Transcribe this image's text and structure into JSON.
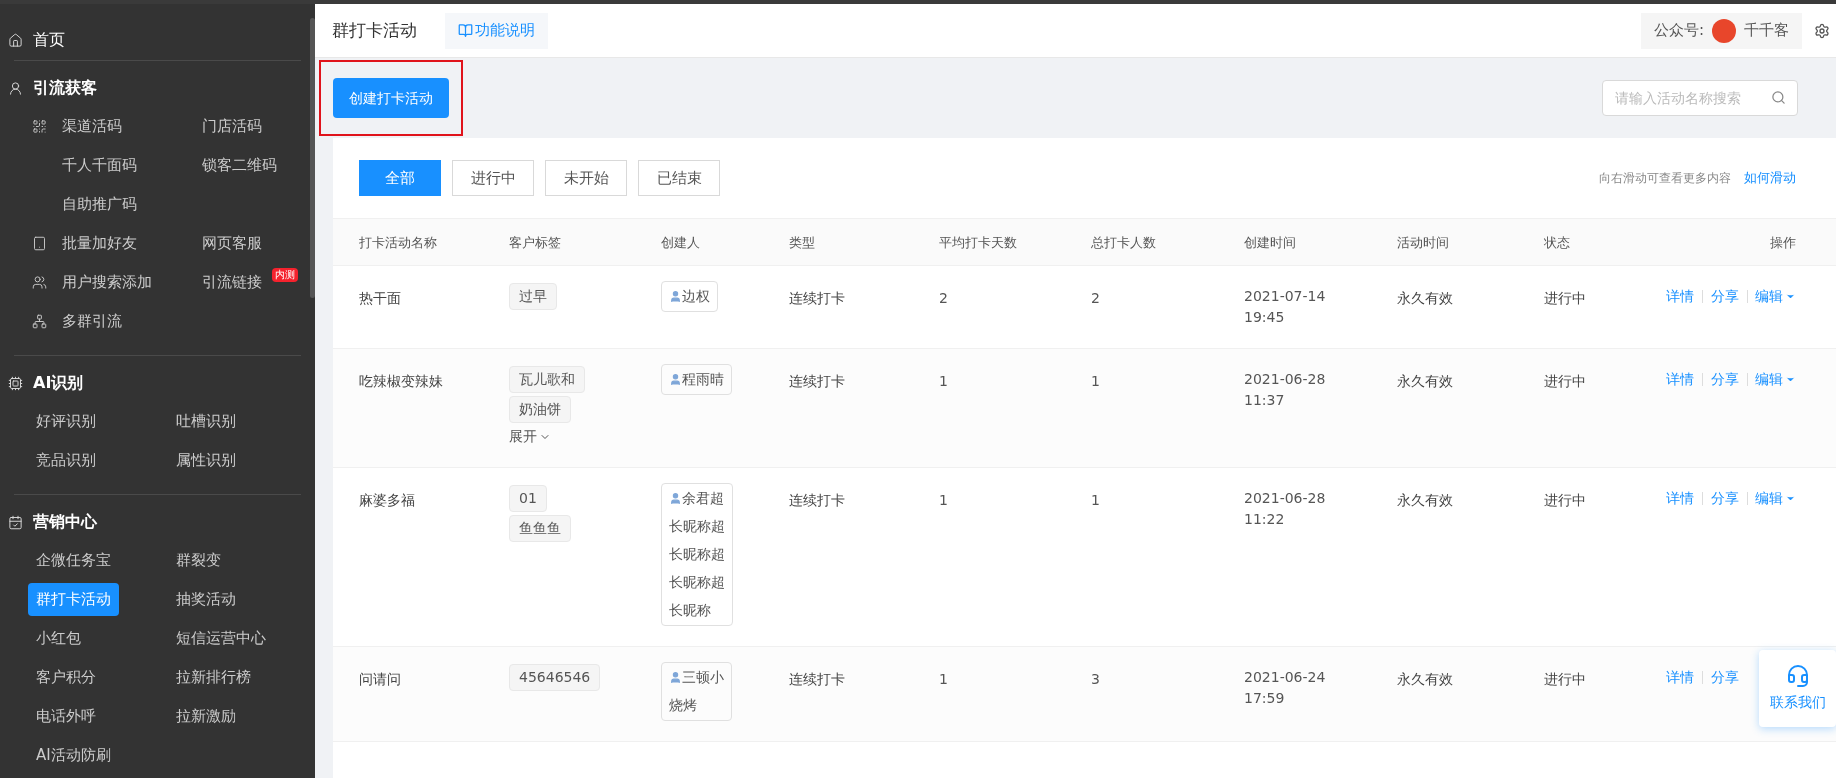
{
  "sidebar": {
    "home": {
      "label": "首页"
    },
    "sections": [
      {
        "title": "引流获客",
        "items": [
          {
            "label": "渠道活码",
            "selected": false
          },
          {
            "label": "门店活码",
            "selected": false
          },
          {
            "label": "千人千面码",
            "selected": false
          },
          {
            "label": "锁客二维码",
            "selected": false
          },
          {
            "label": "自助推广码",
            "selected": false,
            "kind": "wide"
          },
          {
            "label": "批量加好友",
            "selected": false
          },
          {
            "label": "网页客服",
            "selected": false
          },
          {
            "label": "用户搜索添加",
            "selected": false
          },
          {
            "label": "引流链接",
            "selected": false,
            "badge": "内测"
          },
          {
            "label": "多群引流",
            "selected": false
          }
        ]
      },
      {
        "title": "AI识别",
        "items": [
          {
            "label": "好评识别",
            "selected": false
          },
          {
            "label": "吐槽识别",
            "selected": false
          },
          {
            "label": "竞品识别",
            "selected": false
          },
          {
            "label": "属性识别",
            "selected": false
          }
        ]
      },
      {
        "title": "营销中心",
        "items": [
          {
            "label": "企微任务宝",
            "selected": false
          },
          {
            "label": "群裂变",
            "selected": false
          },
          {
            "label": "群打卡活动",
            "selected": true
          },
          {
            "label": "抽奖活动",
            "selected": false
          },
          {
            "label": "小红包",
            "selected": false
          },
          {
            "label": "短信运营中心",
            "selected": false
          },
          {
            "label": "客户积分",
            "selected": false
          },
          {
            "label": "拉新排行榜",
            "selected": false
          },
          {
            "label": "电话外呼",
            "selected": false
          },
          {
            "label": "拉新激励",
            "selected": false
          },
          {
            "label": "AI活动防刷",
            "selected": false
          }
        ]
      }
    ]
  },
  "header": {
    "title": "群打卡活动",
    "help": "功能说明",
    "account_label": "公众号:",
    "account_name": "千千客"
  },
  "toolbar": {
    "create": "创建打卡活动",
    "search": {
      "placeholder": "请输入活动名称搜索"
    }
  },
  "filters": [
    {
      "label": "全部",
      "selected": true
    },
    {
      "label": "进行中",
      "selected": false
    },
    {
      "label": "未开始",
      "selected": false
    },
    {
      "label": "已结束",
      "selected": false
    }
  ],
  "scroll_hint": {
    "text": "向右滑动可查看更多内容",
    "link": "如何滑动"
  },
  "table": {
    "columns": [
      "打卡活动名称",
      "客户标签",
      "创建人",
      "类型",
      "平均打卡天数",
      "总打卡人数",
      "创建时间",
      "活动时间",
      "状态",
      "操作"
    ],
    "rows": [
      {
        "name": "热干面",
        "tags": [
          "过早"
        ],
        "creators": [
          "边权"
        ],
        "type": "连续打卡",
        "avg_days": "2",
        "total": "2",
        "created": [
          "2021-07-14",
          "19:45"
        ],
        "period": "永久有效",
        "status": "进行中",
        "actions": [
          "详情",
          "分享",
          "编辑"
        ]
      },
      {
        "name": "吃辣椒变辣妹",
        "tags": [
          "瓦儿歌和",
          "奶油饼"
        ],
        "expand": "展开",
        "creators": [
          "程雨晴"
        ],
        "type": "连续打卡",
        "avg_days": "1",
        "total": "1",
        "created": [
          "2021-06-28",
          "11:37"
        ],
        "period": "永久有效",
        "status": "进行中",
        "actions": [
          "详情",
          "分享",
          "编辑"
        ]
      },
      {
        "name": "麻婆多福",
        "tags": [
          "01",
          "鱼鱼鱼"
        ],
        "creators": [
          "余君超",
          "长昵称超",
          "长昵称超",
          "长昵称超",
          "长昵称"
        ],
        "type": "连续打卡",
        "avg_days": "1",
        "total": "1",
        "created": [
          "2021-06-28",
          "11:22"
        ],
        "period": "永久有效",
        "status": "进行中",
        "actions": [
          "详情",
          "分享",
          "编辑"
        ]
      },
      {
        "name": "问请问",
        "tags": [
          "45646546"
        ],
        "creators": [
          "三顿小",
          "烧烤"
        ],
        "type": "连续打卡",
        "avg_days": "1",
        "total": "3",
        "created": [
          "2021-06-24",
          "17:59"
        ],
        "period": "永久有效",
        "status": "进行中",
        "actions": [
          "详情",
          "分享"
        ]
      }
    ]
  },
  "contact": {
    "label": "联系我们"
  }
}
